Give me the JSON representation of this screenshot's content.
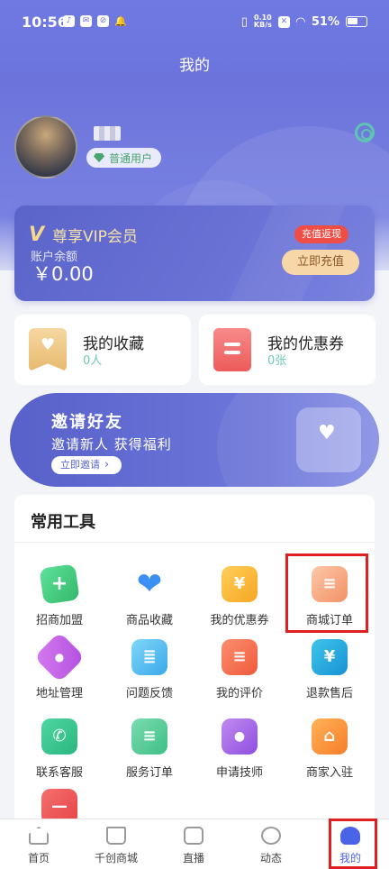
{
  "status_bar": {
    "time": "10:56",
    "net_speed_value": "0.10",
    "net_speed_unit": "KB/s",
    "battery": "51%"
  },
  "header": {
    "title": "我的"
  },
  "profile": {
    "user_level": "普通用户"
  },
  "vip": {
    "mark": "V",
    "title": "尊享VIP会员",
    "balance_label": "账户余额",
    "balance": "￥0.00",
    "promo_tag": "充值返现",
    "recharge_button": "立即充值"
  },
  "quick_cards": [
    {
      "title": "我的收藏",
      "count": "0人"
    },
    {
      "title": "我的优惠券",
      "count": "0张"
    }
  ],
  "invite": {
    "title": "邀请好友",
    "subtitle": "邀请新人 获得福利",
    "button": "立即邀请"
  },
  "tools": {
    "title": "常用工具",
    "items": [
      {
        "label": "招商加盟",
        "icon": "franchise-plus-icon"
      },
      {
        "label": "商品收藏",
        "icon": "heart-icon"
      },
      {
        "label": "我的优惠券",
        "icon": "coupon-icon"
      },
      {
        "label": "商城订单",
        "icon": "order-document-icon"
      },
      {
        "label": "地址管理",
        "icon": "location-pin-icon"
      },
      {
        "label": "问题反馈",
        "icon": "feedback-icon"
      },
      {
        "label": "我的评价",
        "icon": "review-icon"
      },
      {
        "label": "退款售后",
        "icon": "refund-icon"
      },
      {
        "label": "联系客服",
        "icon": "phone-icon"
      },
      {
        "label": "服务订单",
        "icon": "service-order-icon"
      },
      {
        "label": "申请技师",
        "icon": "technician-icon"
      },
      {
        "label": "商家入驻",
        "icon": "shop-icon"
      }
    ]
  },
  "tabbar": [
    {
      "label": "首页",
      "icon": "home-icon"
    },
    {
      "label": "千创商城",
      "icon": "shopping-bag-icon"
    },
    {
      "label": "直播",
      "icon": "tv-live-icon"
    },
    {
      "label": "动态",
      "icon": "pinwheel-icon"
    },
    {
      "label": "我的",
      "icon": "user-icon",
      "active": true
    }
  ],
  "colors": {
    "accent": "#6c74dc",
    "highlight": "#e02020",
    "active_tab": "#4b63e6"
  }
}
